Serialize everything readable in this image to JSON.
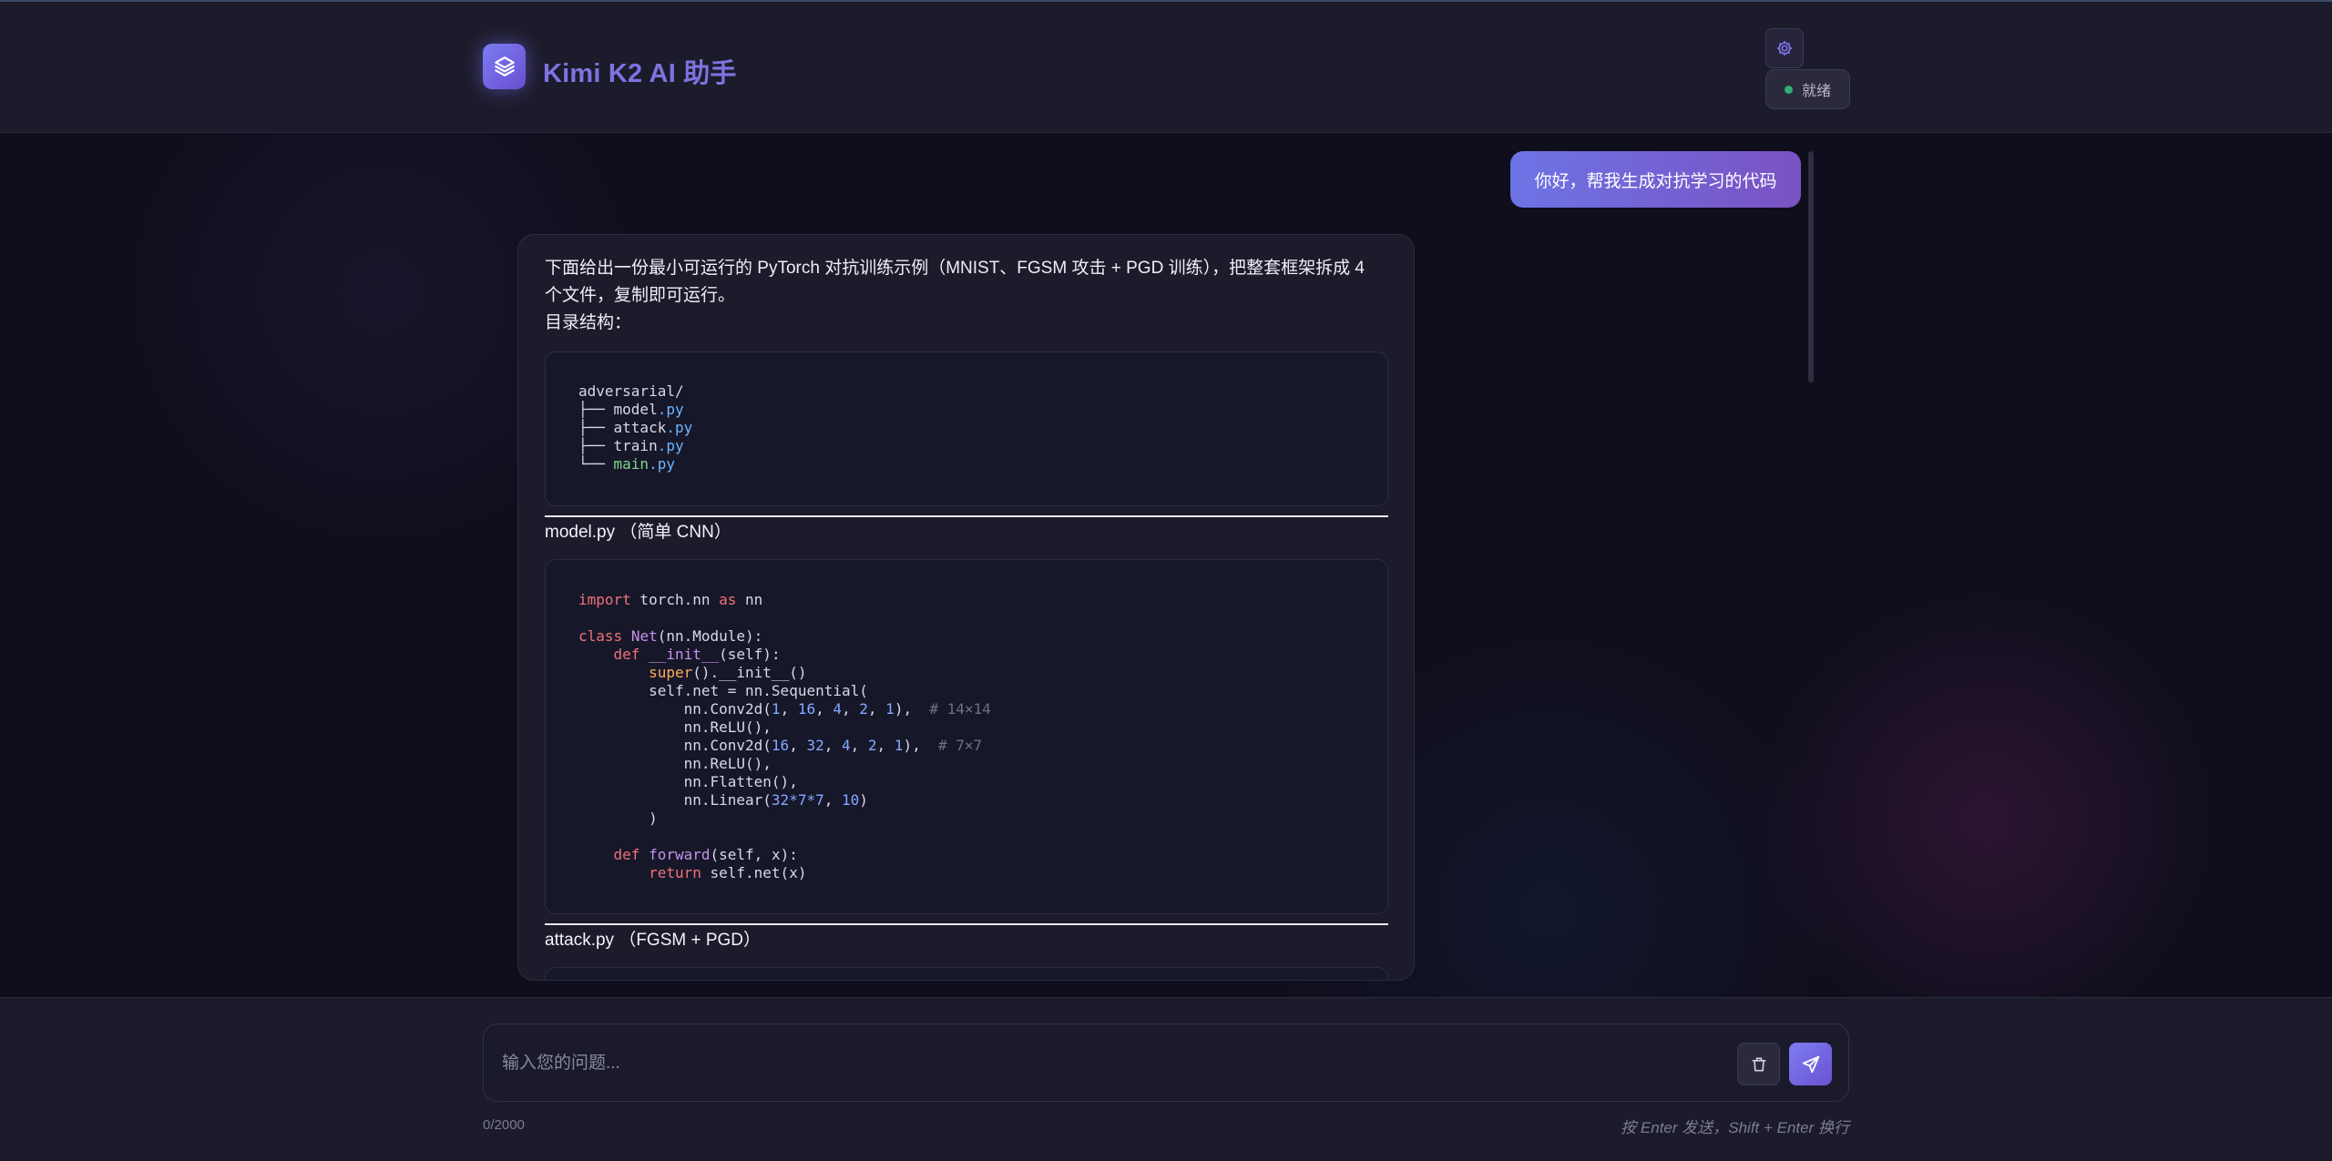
{
  "header": {
    "title": "Kimi K2 AI 助手",
    "status": "就绪",
    "icons": {
      "logo": "layers-icon",
      "settings": "gear-icon"
    }
  },
  "messages": {
    "user": "你好，帮我生成对抗学习的代码",
    "assistant": {
      "intro_line1": "下面给出一份最小可运行的 PyTorch 对抗训练示例（MNIST、FGSM 攻击 + PGD 训练），把整套框架拆成 4",
      "intro_line2": "个文件，复制即可运行。",
      "dir_label": "目录结构：",
      "tree": {
        "root": "adversarial/",
        "files": [
          {
            "prefix": "├── ",
            "name": "model",
            "ext": ".py"
          },
          {
            "prefix": "├── ",
            "name": "attack",
            "ext": ".py"
          },
          {
            "prefix": "├── ",
            "name": "train",
            "ext": ".py"
          },
          {
            "prefix": "└── ",
            "name": "main",
            "ext": ".py"
          }
        ]
      },
      "section_model": "model.py （简单 CNN）",
      "section_attack": "attack.py （FGSM + PGD）",
      "code_model": {
        "l1_import": "import",
        "l1_mod": " torch.nn ",
        "l1_as": "as",
        "l1_alias": " nn",
        "l3_class": "class",
        "l3_name": "Net",
        "l3_rest": "(nn.Module):",
        "l4_def": "def",
        "l4_name": "__init__",
        "l4_rest": "(self):",
        "l5_super": "super",
        "l5_rest": "().__init__()",
        "l6": "self.net = nn.Sequential(",
        "l7_a": "nn.Conv2d(",
        "l7_comment": "# 14×14",
        "l8": "nn.ReLU(),",
        "l9_a": "nn.Conv2d(",
        "l9_comment": "# 7×7",
        "l10": "nn.ReLU(),",
        "l11": "nn.Flatten(),",
        "l12_a": "nn.Linear(",
        "l13": ")",
        "l15_def": "def",
        "l15_name": "forward",
        "l15_rest": "(self, x):",
        "l16_ret": "return",
        "l16_rest": " self.net(x)"
      }
    }
  },
  "input": {
    "placeholder": "输入您的问题...",
    "counter": "0/2000",
    "hint": "按 Enter 发送，Shift + Enter 换行",
    "icons": {
      "clear": "trash-icon",
      "send": "send-icon"
    }
  }
}
